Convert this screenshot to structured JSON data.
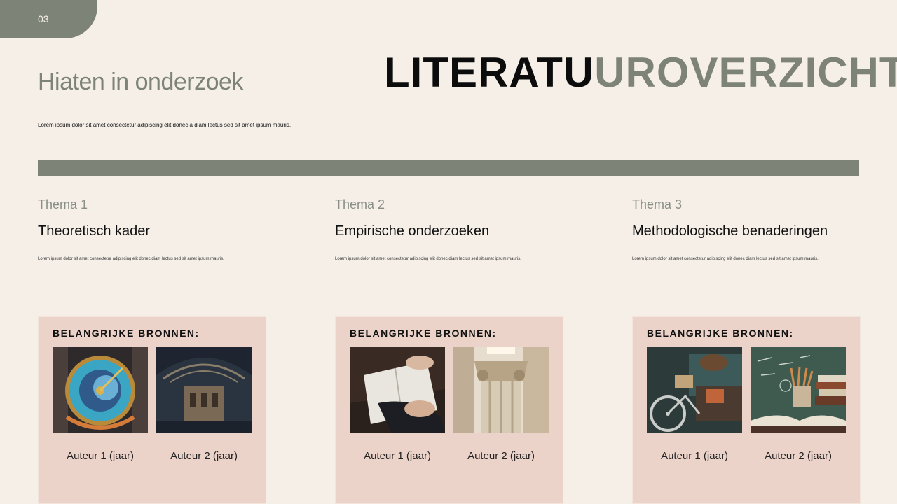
{
  "slide": {
    "number": "03"
  },
  "header": {
    "subtitle": "Hiaten in onderzoek",
    "intro": "Lorem ipsum dolor sit amet consectetur adipiscing elit donec a diam lectus sed sit amet ipsum mauris.",
    "title_dark": "LITERATU",
    "title_muted": "UROVERZICHT"
  },
  "colors": {
    "accent": "#7d8377",
    "card": "#ecd3c9",
    "background": "#f5efe8"
  },
  "columns": [
    {
      "label": "Thema 1",
      "heading": "Theoretisch kader",
      "description": "Lorem ipsum dolor sit amet consectetur adipiscing elit donec diam lectus sed sit amet ipsum mauris.",
      "sources_title": "BELANGRIJKE BRONNEN:",
      "images": [
        "astronomical-clock-photo",
        "museum-hall-photo"
      ],
      "authors": [
        "Auteur 1 (jaar)",
        "Auteur 2 (jaar)"
      ]
    },
    {
      "label": "Thema 2",
      "heading": "Empirische onderzoeken",
      "description": "Lorem ipsum dolor sit amet consectetur adipiscing elit donec diam lectus sed sit amet ipsum mauris.",
      "sources_title": "BELANGRIJKE BRONNEN:",
      "images": [
        "reading-book-photo",
        "column-capital-photo"
      ],
      "authors": [
        "Auteur 1 (jaar)",
        "Auteur 2 (jaar)"
      ]
    },
    {
      "label": "Thema 3",
      "heading": "Methodologische benaderingen",
      "description": "Lorem ipsum dolor sit amet consectetur adipiscing elit donec diam lectus sed sit amet ipsum mauris.",
      "sources_title": "BELANGRIJKE BRONNEN:",
      "images": [
        "bicycle-desk-photo",
        "chalkboard-books-photo"
      ],
      "authors": [
        "Auteur 1 (jaar)",
        "Auteur 2 (jaar)"
      ]
    }
  ]
}
